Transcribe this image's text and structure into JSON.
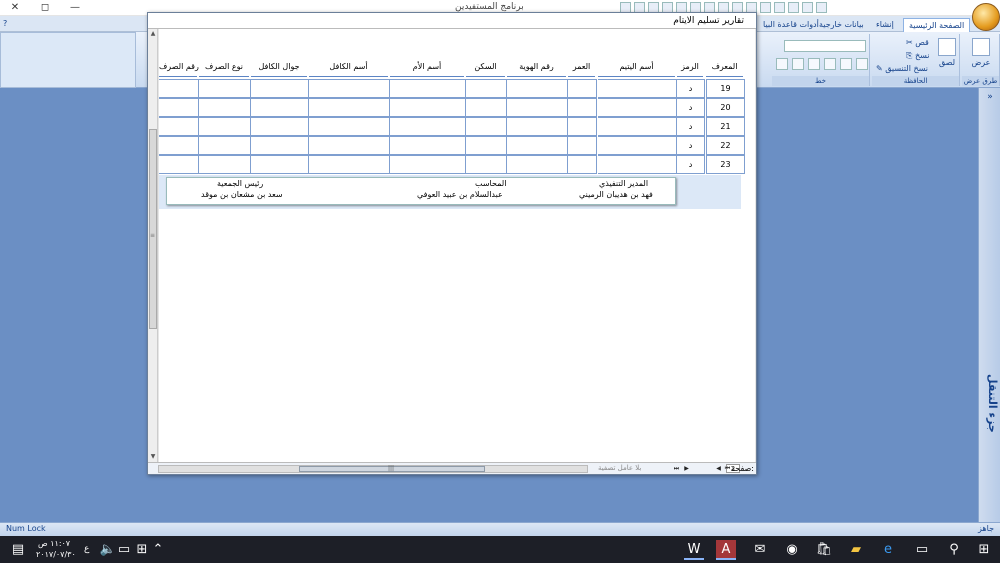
{
  "app": {
    "title": "برنامج المستفيدين",
    "window_controls": {
      "close": "✕",
      "restore": "◻",
      "minimize": "—"
    }
  },
  "ribbon": {
    "tabs": [
      "الصفحة الرئيسية",
      "إنشاء",
      "بيانات خارجية",
      "أدوات قاعدة البيا"
    ],
    "groups": {
      "views": {
        "title": "طرق عرض",
        "view_label": "عرض"
      },
      "clipboard": {
        "title": "الحافظة",
        "paste_label": "لصق",
        "cut_label": "قص",
        "copy_label": "نسخ",
        "format_painter_label": "نسخ التنسيق"
      },
      "font": {
        "title": "خط"
      }
    },
    "help_icon": "?"
  },
  "nav_pane": {
    "label": "جزء التنقل",
    "expand_glyph": "»"
  },
  "status_bar": {
    "ready": "جاهز",
    "num_lock": "Num Lock"
  },
  "report": {
    "title": "تقارير تسليم الايتام",
    "columns": [
      "المعرف",
      "الرمز",
      "أسم اليتيم",
      "العمر",
      "رقم الهوية",
      "السكن",
      "أسم الأم",
      "أسم الكافل",
      "جوال الكافل",
      "نوع الصرف",
      "رقم الصرف"
    ],
    "rows": [
      {
        "id": "19",
        "code": "د"
      },
      {
        "id": "20",
        "code": "د"
      },
      {
        "id": "21",
        "code": "د"
      },
      {
        "id": "22",
        "code": "د"
      },
      {
        "id": "23",
        "code": "د"
      }
    ],
    "signatures": [
      {
        "title": "المدير التنفيذي",
        "name": "فهد بن هديبان الرميني"
      },
      {
        "title": "المحاسب",
        "name": "عبدالسلام بن عبيد العوفي"
      },
      {
        "title": "رئيس الجمعية",
        "name": "سعد بن مشعان بن موقد"
      }
    ],
    "navigation": {
      "page_label": "صفحة:",
      "current_page": "2",
      "filter_label": "بلا عامل تصفية",
      "first": "⏮",
      "prev": "◀",
      "next": "▶",
      "last": "⏭"
    }
  },
  "taskbar": {
    "time": "١١:٠٧ ص",
    "date": "٢٠١٧/٠٧/٣٠",
    "lang": "ع",
    "icons": [
      "windows-logo",
      "search",
      "task-view",
      "edge",
      "explorer",
      "store",
      "chrome",
      "mail",
      "access",
      "word"
    ]
  }
}
